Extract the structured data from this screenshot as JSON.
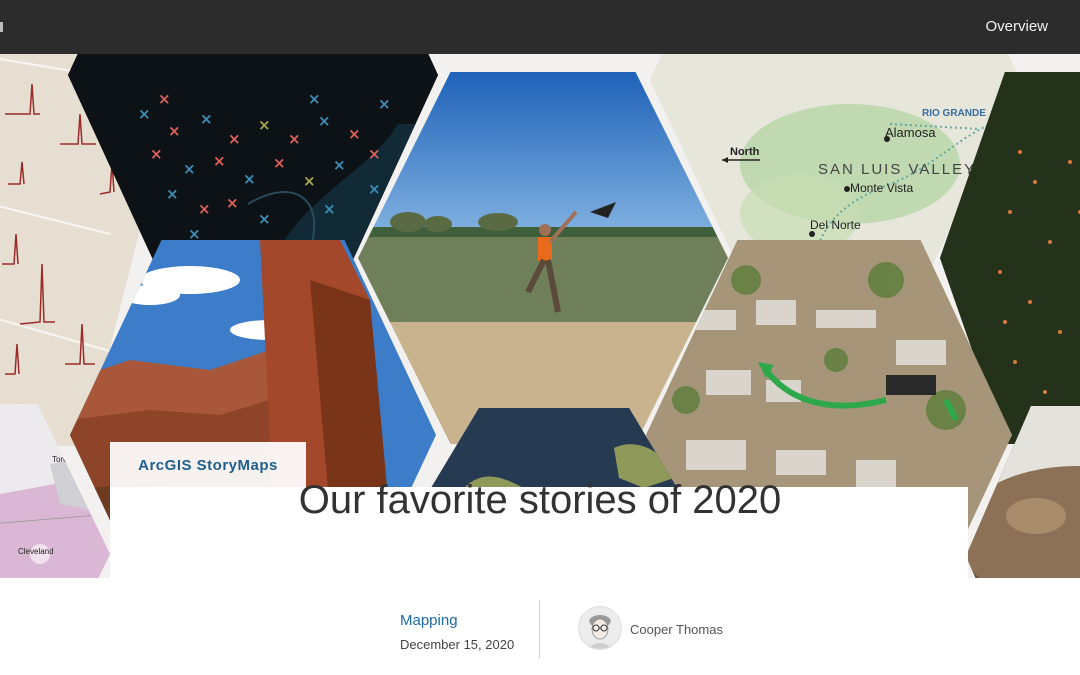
{
  "nav": {
    "overview_label": "Overview"
  },
  "hero": {
    "brand_label": "ArcGIS StoryMaps",
    "map_labels": {
      "river": "RIO GRANDE",
      "city1": "Alamosa",
      "north": "North",
      "region": "SAN   LUIS   VALLEY",
      "city2": "Monte Vista",
      "city3": "Del Norte",
      "toronto": "Toronto",
      "cleveland": "Cleveland"
    }
  },
  "article": {
    "title": "Our favorite stories of 2020",
    "category": "Mapping",
    "date": "December 15, 2020",
    "author": "Cooper Thomas"
  },
  "colors": {
    "topbar": "#2c2c2c",
    "brand_text": "#1d5f8e",
    "category_link": "#1b6ba8",
    "mosaic_bg": "#f2f1ef"
  },
  "icons": {
    "avatar": "person-avatar-icon"
  }
}
